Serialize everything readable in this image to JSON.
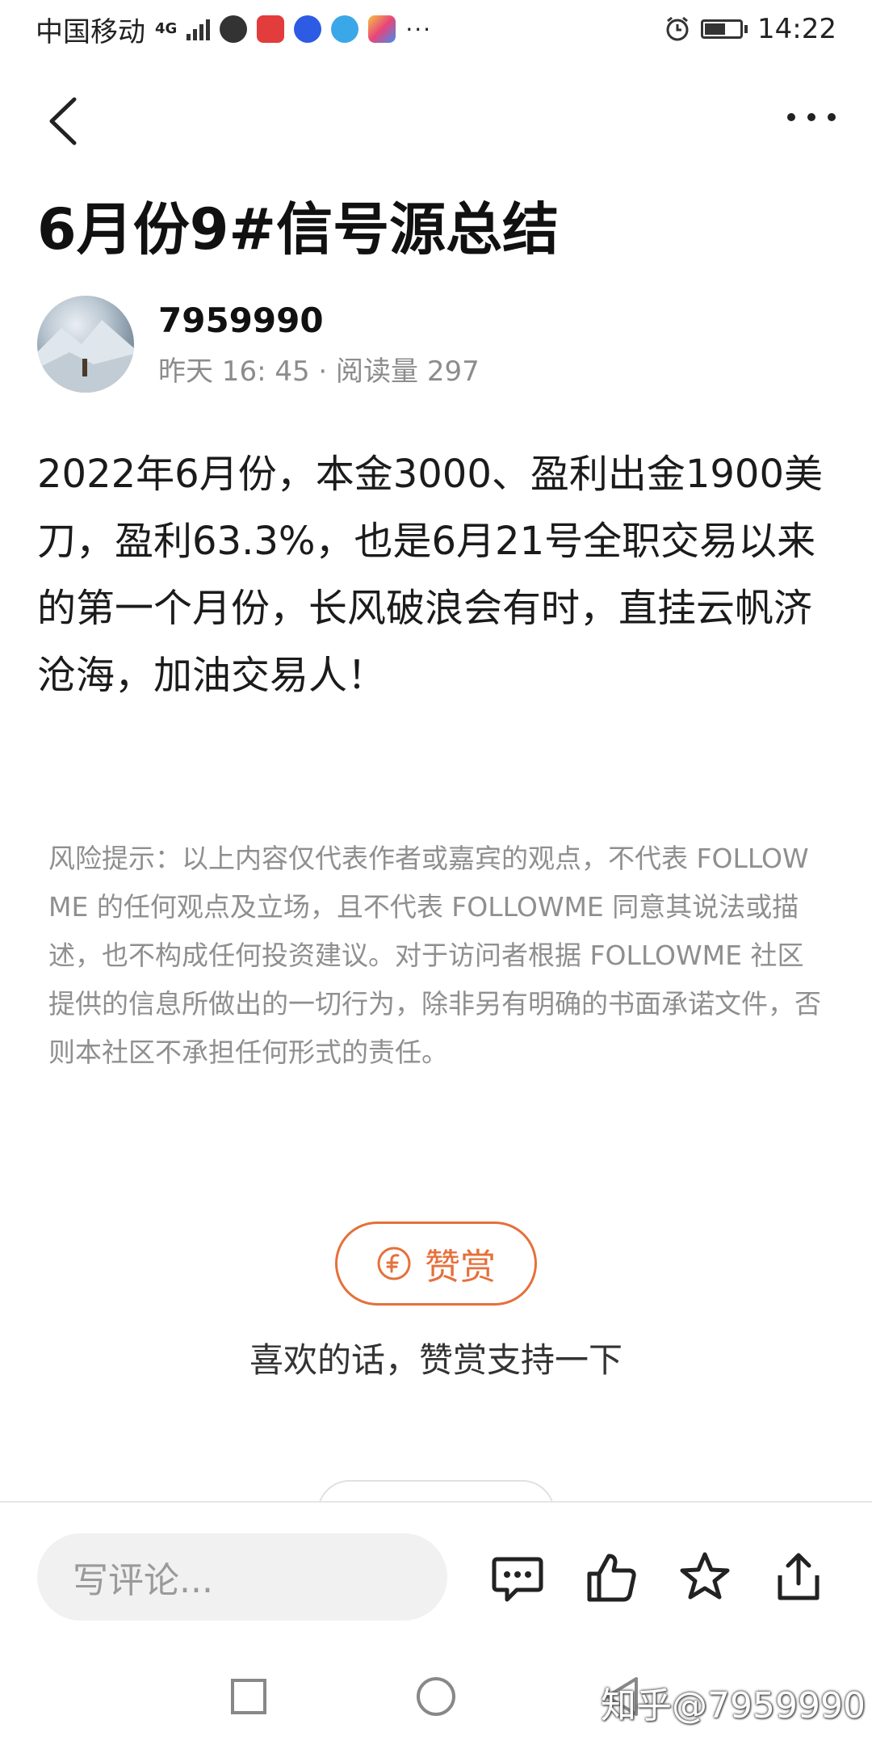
{
  "status_bar": {
    "carrier": "中国移动",
    "network": "4G",
    "time": "14:22"
  },
  "article": {
    "title": "6月份9#信号源总结",
    "author_name": "7959990",
    "meta": "昨天 16: 45 · 阅读量 297",
    "body": "2022年6月份，本金3000、盈利出金1900美刀，盈利63.3%，也是6月21号全职交易以来的第一个月份，长风破浪会有时，直挂云帆济沧海，加油交易人！",
    "disclaimer": "风险提示：以上内容仅代表作者或嘉宾的观点，不代表 FOLLOWME 的任何观点及立场，且不代表 FOLLOWME 同意其说法或描述，也不构成任何投资建议。对于访问者根据 FOLLOWME 社区提供的信息所做出的一切行为，除非另有明确的书面承诺文件，否则本社区不承担任何形式的责任。"
  },
  "reward": {
    "button_label": "赞赏",
    "hint": "喜欢的话，赞赏支持一下"
  },
  "action_bar": {
    "comment_placeholder": "写评论..."
  },
  "watermark": "知乎@7959990",
  "colors": {
    "accent": "#e5703b",
    "muted_text": "#8f8f8f",
    "input_bg": "#f1f1f1"
  },
  "icons": {
    "nav": [
      "back-arrow-icon",
      "more-icon"
    ],
    "actions": [
      "comment-icon",
      "like-icon",
      "star-icon",
      "share-icon"
    ],
    "system": [
      "recents-icon",
      "home-icon",
      "back-icon"
    ]
  }
}
